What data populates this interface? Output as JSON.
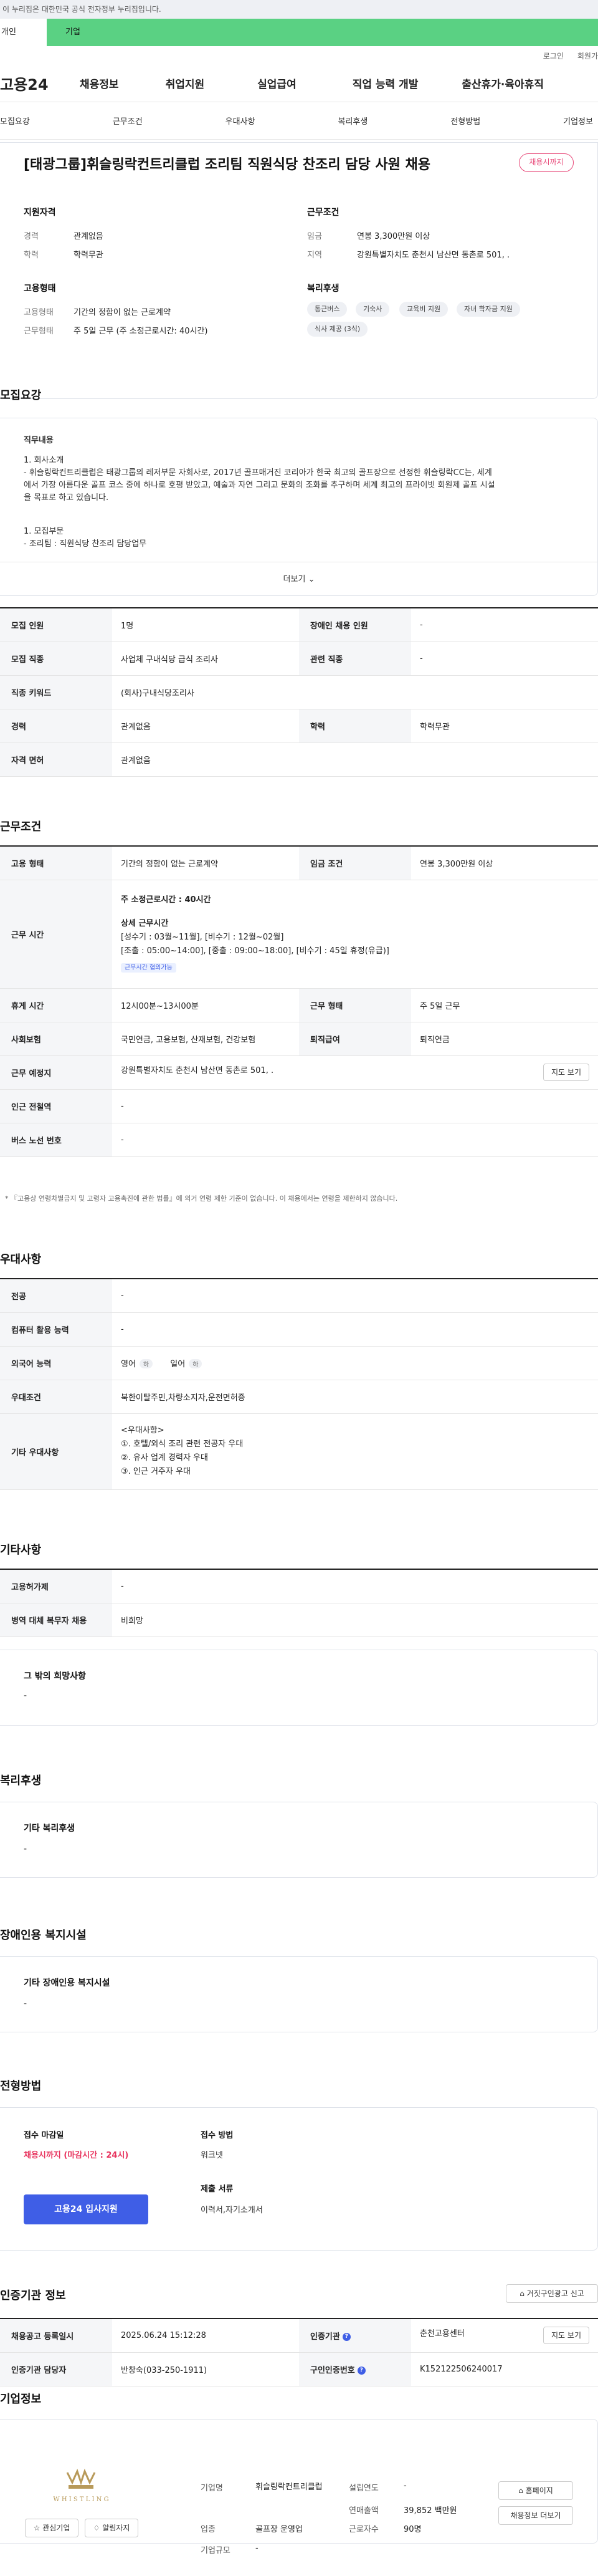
{
  "gov_banner": "이 누리집은 대한민국 공식 전자정부 누리집입니다.",
  "top_tabs": {
    "individual": "개인",
    "business": "기업"
  },
  "util": {
    "login": "로그인",
    "signup": "회원가"
  },
  "gnb": {
    "logo": "고용24",
    "items": [
      "채용정보",
      "취업지원",
      "실업급여",
      "직업 능력 개발",
      "출산휴가·육아휴직"
    ]
  },
  "subnav": [
    "모집요강",
    "근무조건",
    "우대사항",
    "복리후생",
    "전형방법",
    "기업정보"
  ],
  "job": {
    "title": "[태광그룹]휘슬링락컨트리클럽 조리팀 직원식당 찬조리 담당 사원 채용",
    "status": "채용시까지"
  },
  "summary": {
    "qual_head": "지원자격",
    "career_label": "경력",
    "career": "관계없음",
    "edu_label": "학력",
    "edu": "학력무관",
    "work_head": "근무조건",
    "wage_label": "임금",
    "wage": "연봉 3,300만원 이상",
    "region_label": "지역",
    "region": "강원특별자치도 춘천시 남산면 동촌로 501, .",
    "emp_head": "고용형태",
    "emptype_label": "고용형태",
    "emptype": "기간의 정함이 없는 근로계약",
    "workform_label": "근무형태",
    "workform": "주 5일 근무 (주 소정근로시간: 40시간)",
    "welfare_head": "복리후생",
    "chips": [
      "통근버스",
      "기숙사",
      "교육비 지원",
      "자녀 학자금 지원",
      "식사 제공 (3식)"
    ]
  },
  "recruit": {
    "title": "모집요강",
    "duty_head": "직무내용",
    "lines": [
      "1. 회사소개",
      "- 휘슬링락컨트리클럽은 태광그룹의 레저부문 자회사로, 2017년 골프매거진 코리아가 한국 최고의 골프장으로 선정한 휘슬링락CC는, 세계",
      "에서 가장 아름다운 골프 코스 중에 하나로 호평 받았고, 예술과 자연 그리고 문화의 조화를 추구하며 세계 최고의 프라이빗 회원제 골프 시설",
      "을 목표로 하고 있습니다.",
      "",
      "1. 모집부문",
      "- 조리팀 : 직원식당 찬조리 담당업무"
    ],
    "more": "더보기",
    "table": [
      [
        "모집 인원",
        "1명",
        "장애인 채용 인원",
        "-"
      ],
      [
        "모집 직종",
        "사업체 구내식당 급식 조리사",
        "관련 직종",
        "-"
      ],
      [
        "직종 키워드",
        "(회사)구내식당조리사"
      ],
      [
        "경력",
        "관계없음",
        "학력",
        "학력무관"
      ],
      [
        "자격 면허",
        "관계없음"
      ]
    ]
  },
  "conditions": {
    "title": "근무조건",
    "emptype_label": "고용 형태",
    "emptype": "기간의 정함이 없는 근로계약",
    "wage_label": "임금 조건",
    "wage": "연봉 3,300만원 이상",
    "time_label": "근무 시간",
    "weekly_hours": "주 소정근로시간 : 40시간",
    "detail_head": "상세 근무시간",
    "detail_lines": [
      "[성수기 : 03월~11월], [비수기 : 12월~02월]",
      "[조출 : 05:00~14:00], [중출 : 09:00~18:00], [비수기 : 45일 휴정(유급)]"
    ],
    "consult_tag": "근무시간 협의가능",
    "break_label": "휴게 시간",
    "break": "12시00분~13시00분",
    "workform_label": "근무 형태",
    "workform": "주 5일 근무",
    "insurance_label": "사회보험",
    "insurance": "국민연금, 고용보험, 산재보험, 건강보험",
    "severance_label": "퇴직급여",
    "severance": "퇴직연금",
    "place_label": "근무 예정지",
    "place": "강원특별자치도 춘천시 남산면 동촌로 501, .",
    "map_btn": "지도 보기",
    "subway_label": "인근 전철역",
    "subway": "-",
    "bus_label": "버스 노선 번호",
    "bus": "-",
    "note": "* 『고용상 연령차별금지 및 고령자 고용촉진에 관한 법률』에 의거 연령 제한 기준이 없습니다. 이 채용에서는 연령을 제한하지 않습니다."
  },
  "preference": {
    "title": "우대사항",
    "major_label": "전공",
    "major": "-",
    "computer_label": "컴퓨터 활용 능력",
    "computer": "-",
    "lang_label": "외국어 능력",
    "lang": [
      {
        "name": "영어",
        "level": "하"
      },
      {
        "name": "일어",
        "level": "하"
      }
    ],
    "pref_label": "우대조건",
    "pref": "북한이탈주민,차량소지자,운전면허증",
    "other_label": "기타 우대사항",
    "other_lines": [
      "<우대사항>",
      "①. 호텔/외식 조리 관련 전공자 우대",
      "②. 유사 업계 경력자 우대",
      "③. 인근 거주자 우대"
    ]
  },
  "etc": {
    "title": "기타사항",
    "insurance_label": "고용허가제",
    "insurance": "-",
    "military_label": "병역 대체 복무자 채용",
    "military": "비희망",
    "wish_label": "그 밖의 희망사항",
    "wish": "-"
  },
  "welfare": {
    "title": "복리후생",
    "label": "기타 복리후생",
    "value": "-"
  },
  "disability": {
    "title": "장애인용 복지시설",
    "label": "기타 장애인용 복지시설",
    "value": "-"
  },
  "process": {
    "title": "전형방법",
    "deadline_label": "접수 마감일",
    "deadline": "채용시까지 (마감시간 : 24시)",
    "method_label": "접수 방법",
    "method": "워크넷",
    "docs_label": "제출 서류",
    "docs": "이력서,자기소개서",
    "apply": "고용24 입사지원"
  },
  "cert": {
    "title": "인증기관 정보",
    "report": "거짓구인광고 신고",
    "reg_label": "채용공고 등록일시",
    "reg": "2025.06.24 15:12:28",
    "org_label": "인증기관",
    "org": "춘천고용센터",
    "map_btn": "지도 보기",
    "mgr_label": "인증기관 담당자",
    "mgr": "반창숙(033-250-1911)",
    "no_label": "구인인증번호",
    "no": "K152122506240017"
  },
  "company": {
    "title": "기업정보",
    "name_label": "기업명",
    "name": "휘슬링락컨트리클럽",
    "industry_label": "업종",
    "industry": "골프장 운영업",
    "size_label": "기업규모",
    "size": "-",
    "founded_label": "설립연도",
    "founded": "-",
    "sales_label": "연매출액",
    "sales": "39,852 백만원",
    "staff_label": "근로자수",
    "staff": "90명",
    "homepage": "홈페이지",
    "more_jobs": "채용정보 더보기",
    "fav": "관심기업",
    "follow": "알림자지"
  }
}
